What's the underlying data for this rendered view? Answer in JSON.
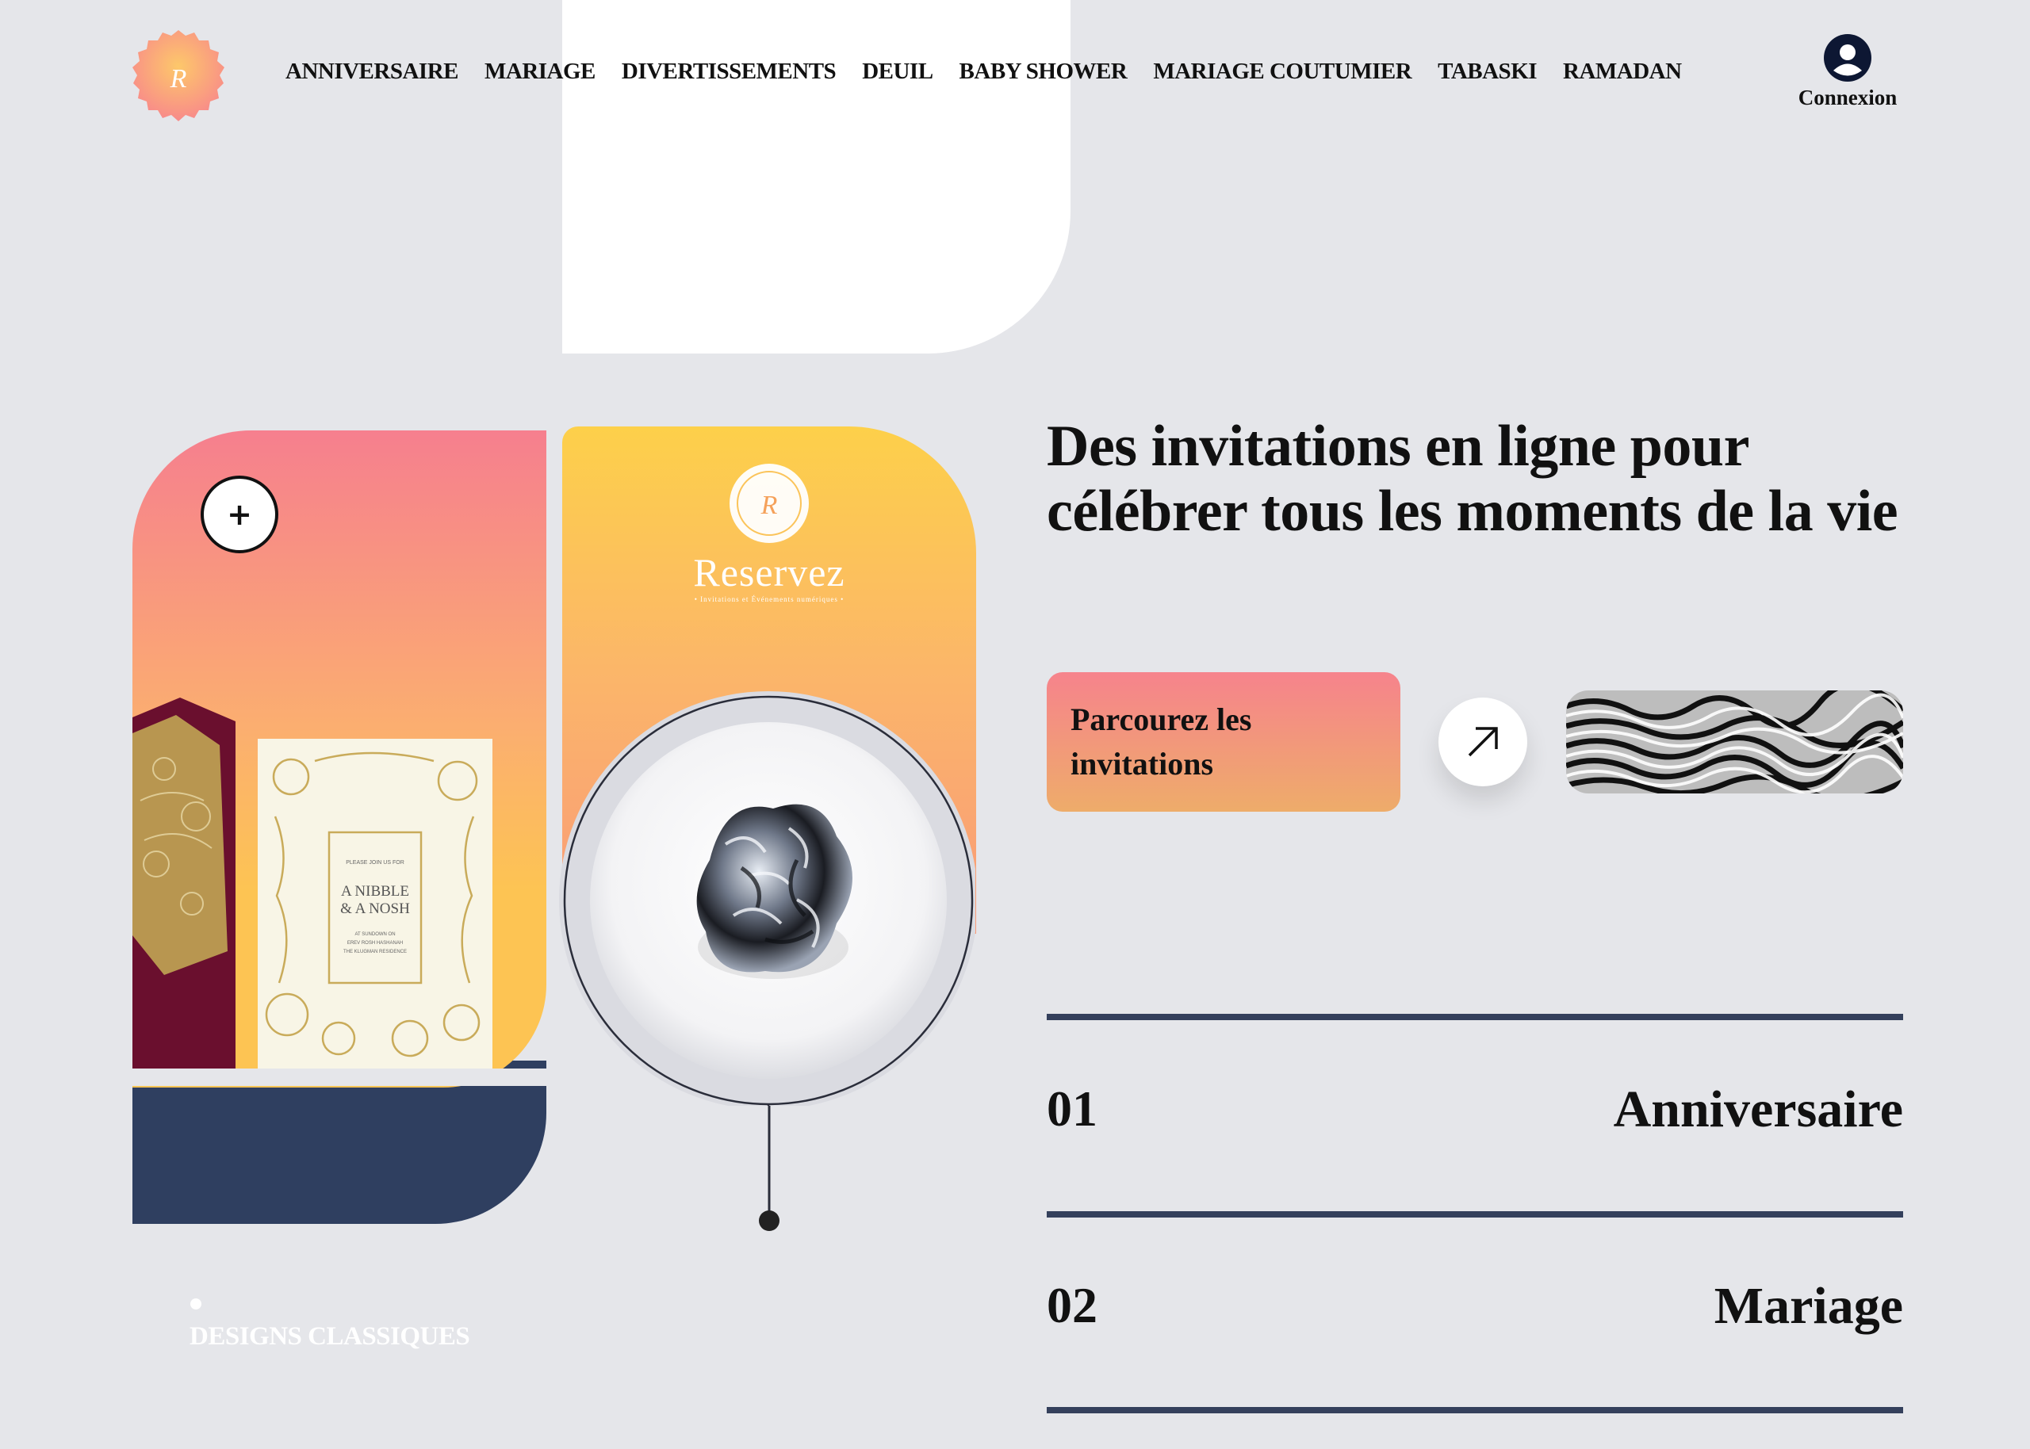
{
  "header": {
    "logo_alt": "Reservez logo",
    "nav": [
      {
        "label": "ANNIVERSAIRE"
      },
      {
        "label": "MARIAGE"
      },
      {
        "label": "DIVERTISSEMENTS"
      },
      {
        "label": "DEUIL"
      },
      {
        "label": "BABY SHOWER"
      },
      {
        "label": "MARIAGE COUTUMIER"
      },
      {
        "label": "TABASKI"
      },
      {
        "label": "RAMADAN"
      }
    ],
    "account_label": "Connexion"
  },
  "visual": {
    "plus_label": "+",
    "brand_name": "Reservez",
    "brand_tagline": "• Invitations et Événements numériques •",
    "invite_lines": [
      "PLEASE JOIN US FOR",
      "A NIBBLE",
      "& A NOSH",
      "AT SUNDOWN ON",
      "EREV ROSH HASHANAH",
      "THE KLUGMAN RESIDENCE"
    ],
    "designs_label": "DESIGNS CLASSIQUES"
  },
  "hero": {
    "title": "Des invitations en ligne pour célébrer tous les moments de la vie",
    "cta_label": "Parcourez les invitations",
    "arrow_icon": "arrow-up-right-icon"
  },
  "categories": [
    {
      "number": "01",
      "label": "Anniversaire"
    },
    {
      "number": "02",
      "label": "Mariage"
    }
  ],
  "colors": {
    "background": "#e5e6ea",
    "navy": "#2f3f60",
    "pink": "#f67f8e",
    "orange": "#fbae70",
    "yellow": "#fdd04a"
  }
}
